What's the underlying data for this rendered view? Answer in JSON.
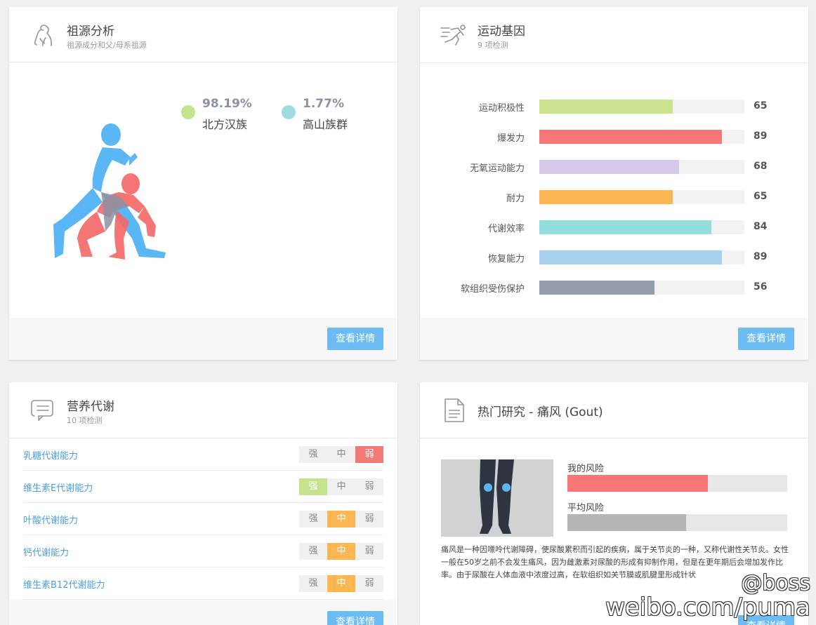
{
  "ancestry": {
    "title": "祖源分析",
    "subtitle": "祖源成分和父/母系祖源",
    "icon": "ape-icon",
    "items": [
      {
        "pct": "98.19%",
        "name": "北方汉族",
        "color": "#c5e38c"
      },
      {
        "pct": "1.77%",
        "name": "高山族群",
        "color": "#9ddde2"
      }
    ],
    "button": "查看详情"
  },
  "sports": {
    "title": "运动基因",
    "subtitle": "9 项检测",
    "icon": "runner-icon",
    "button": "查看详情",
    "genes": [
      {
        "label": "运动积极性",
        "value": 65,
        "display": "65",
        "color": "#c9e48c"
      },
      {
        "label": "爆发力",
        "value": 89,
        "display": "89",
        "color": "#f77676"
      },
      {
        "label": "无氧运动能力",
        "value": 68,
        "display": "68",
        "color": "#d5c9ea"
      },
      {
        "label": "耐力",
        "value": 65,
        "display": "65",
        "color": "#fdb652"
      },
      {
        "label": "代谢效率",
        "value": 84,
        "display": "84",
        "color": "#93dddd"
      },
      {
        "label": "恢复能力",
        "value": 89,
        "display": "89",
        "color": "#a7d3f1"
      },
      {
        "label": "软组织受伤保护",
        "value": 56,
        "display": "56",
        "color": "#939cab"
      }
    ]
  },
  "nutrition": {
    "title": "营养代谢",
    "subtitle": "10 项检测",
    "icon": "document-arrow-icon",
    "button": "查看详情",
    "levels": [
      "强",
      "中",
      "弱"
    ],
    "rows": [
      {
        "label": "乳糖代谢能力",
        "active": 2,
        "color": "#f47a7a"
      },
      {
        "label": "维生素E代谢能力",
        "active": 0,
        "color": "#c5e38c"
      },
      {
        "label": "叶酸代谢能力",
        "active": 1,
        "color": "#fdb652"
      },
      {
        "label": "钙代谢能力",
        "active": 1,
        "color": "#fdb652"
      },
      {
        "label": "维生素B12代谢能力",
        "active": 1,
        "color": "#fdb652"
      }
    ]
  },
  "gout": {
    "title": "热门研究 - 痛风 (Gout)",
    "icon": "document-icon",
    "button": "查看详情",
    "my_risk_label": "我的风险",
    "my_risk": 0.64,
    "my_risk_color": "#f77676",
    "avg_risk_label": "平均风险",
    "avg_risk": 0.54,
    "avg_risk_color": "#b5b5b5",
    "description": "痛风是一种因嘌呤代谢障碍，使尿酸累积而引起的疾病，属于关节炎的一种，又称代谢性关节炎。女性一般在50岁之前不会发生痛风，因为雌激素对尿酸的形成有抑制作用，但是在更年期后会增加发作比率。由于尿酸在人体血液中浓度过高，在软组织如关节膜或肌腱里形成针状"
  },
  "watermark": {
    "line1": "@boss",
    "line2": "weibo.com/puma"
  }
}
